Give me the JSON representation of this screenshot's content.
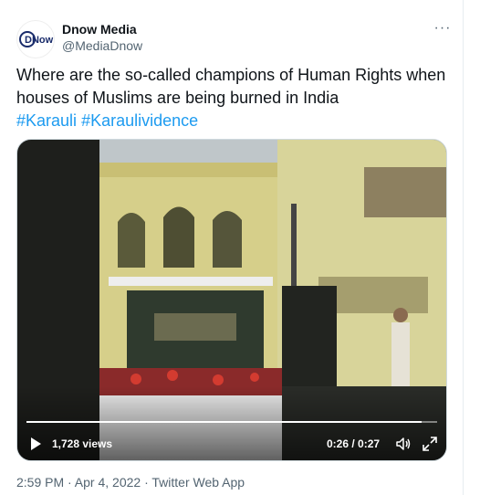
{
  "author": {
    "avatar_text": "DNow",
    "name": "Dnow Media",
    "handle": "@MediaDnow"
  },
  "more_label": "···",
  "tweet": {
    "text": "Where are the so-called champions of Human Rights when houses of Muslims are being burned in India",
    "hashtags": [
      "#Karauli",
      "#Karaulividence"
    ]
  },
  "video": {
    "views": "1,728 views",
    "time": "0:26 / 0:27",
    "progress": 0.963
  },
  "timestamp": "2:59 PM · Apr 4, 2022 · Twitter Web App",
  "colors": {
    "text": "#0f1419",
    "secondary": "#536471",
    "link": "#1d9bf0"
  },
  "icons": {
    "play": "play-icon",
    "volume": "volume-icon",
    "expand": "expand-icon",
    "more": "more-icon"
  }
}
